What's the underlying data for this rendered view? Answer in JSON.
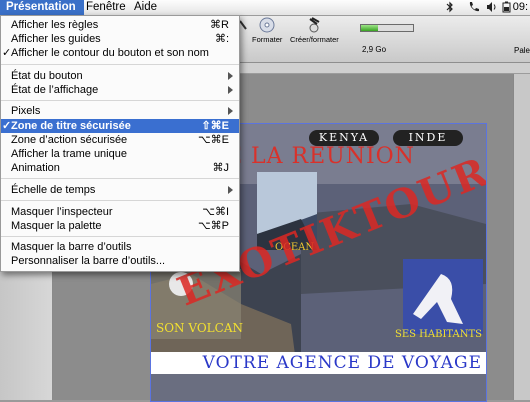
{
  "menubar": {
    "items": [
      {
        "label": "Présentation",
        "active": true
      },
      {
        "label": "Fenêtre",
        "active": false
      },
      {
        "label": "Aide",
        "active": false
      }
    ],
    "status_icons": [
      "bluetooth-icon",
      "phone-icon",
      "volume-icon",
      "battery-icon"
    ],
    "clock": "09:"
  },
  "toolbar": {
    "buttons": [
      {
        "label": "Formater",
        "icon": "disc-icon"
      },
      {
        "label": "Créer/formater",
        "icon": "burn-icon"
      }
    ],
    "progress": 0.32,
    "capacity": "2,9 Go",
    "right_label": "Pale"
  },
  "menu": {
    "items": [
      {
        "label": "Afficher les règles",
        "shortcut": "⌘R"
      },
      {
        "label": "Afficher les guides",
        "shortcut": "⌘:"
      },
      {
        "label": "Afficher le contour du bouton et son nom",
        "checked": true
      },
      {
        "label": "État du bouton",
        "submenu": true
      },
      {
        "label": "État de l’affichage",
        "submenu": true
      },
      {
        "label": "Pixels",
        "submenu": true
      },
      {
        "label": "Zone de titre sécurisée",
        "shortcut": "⇧⌘E",
        "checked": true,
        "highlighted": true
      },
      {
        "label": "Zone d’action sécurisée",
        "shortcut": "⌥⌘E"
      },
      {
        "label": "Afficher la trame unique"
      },
      {
        "label": "Animation",
        "shortcut": "⌘J"
      },
      {
        "label": "Échelle de temps",
        "submenu": true
      },
      {
        "label": "Masquer l’inspecteur",
        "shortcut": "⌥⌘I"
      },
      {
        "label": "Masquer la palette",
        "shortcut": "⌥⌘P"
      },
      {
        "label": "Masquer la barre d’outils"
      },
      {
        "label": "Personnaliser la barre d’outils..."
      }
    ],
    "check_mark": "✓"
  },
  "preview": {
    "title": "ILE DE LA REUNION",
    "buttons": [
      "KENYA",
      "INDE"
    ],
    "ocean": "OCEAN",
    "volcano": "SON VOLCAN",
    "inhabitants": "SES HABITANTS",
    "stamp": "EXOTIKTOUR",
    "tagline": "VOTRE AGENCE DE VOYAGE",
    "accent": "#d9312a",
    "tagline_color": "#2a38c8",
    "label_color": "#f2e030"
  }
}
